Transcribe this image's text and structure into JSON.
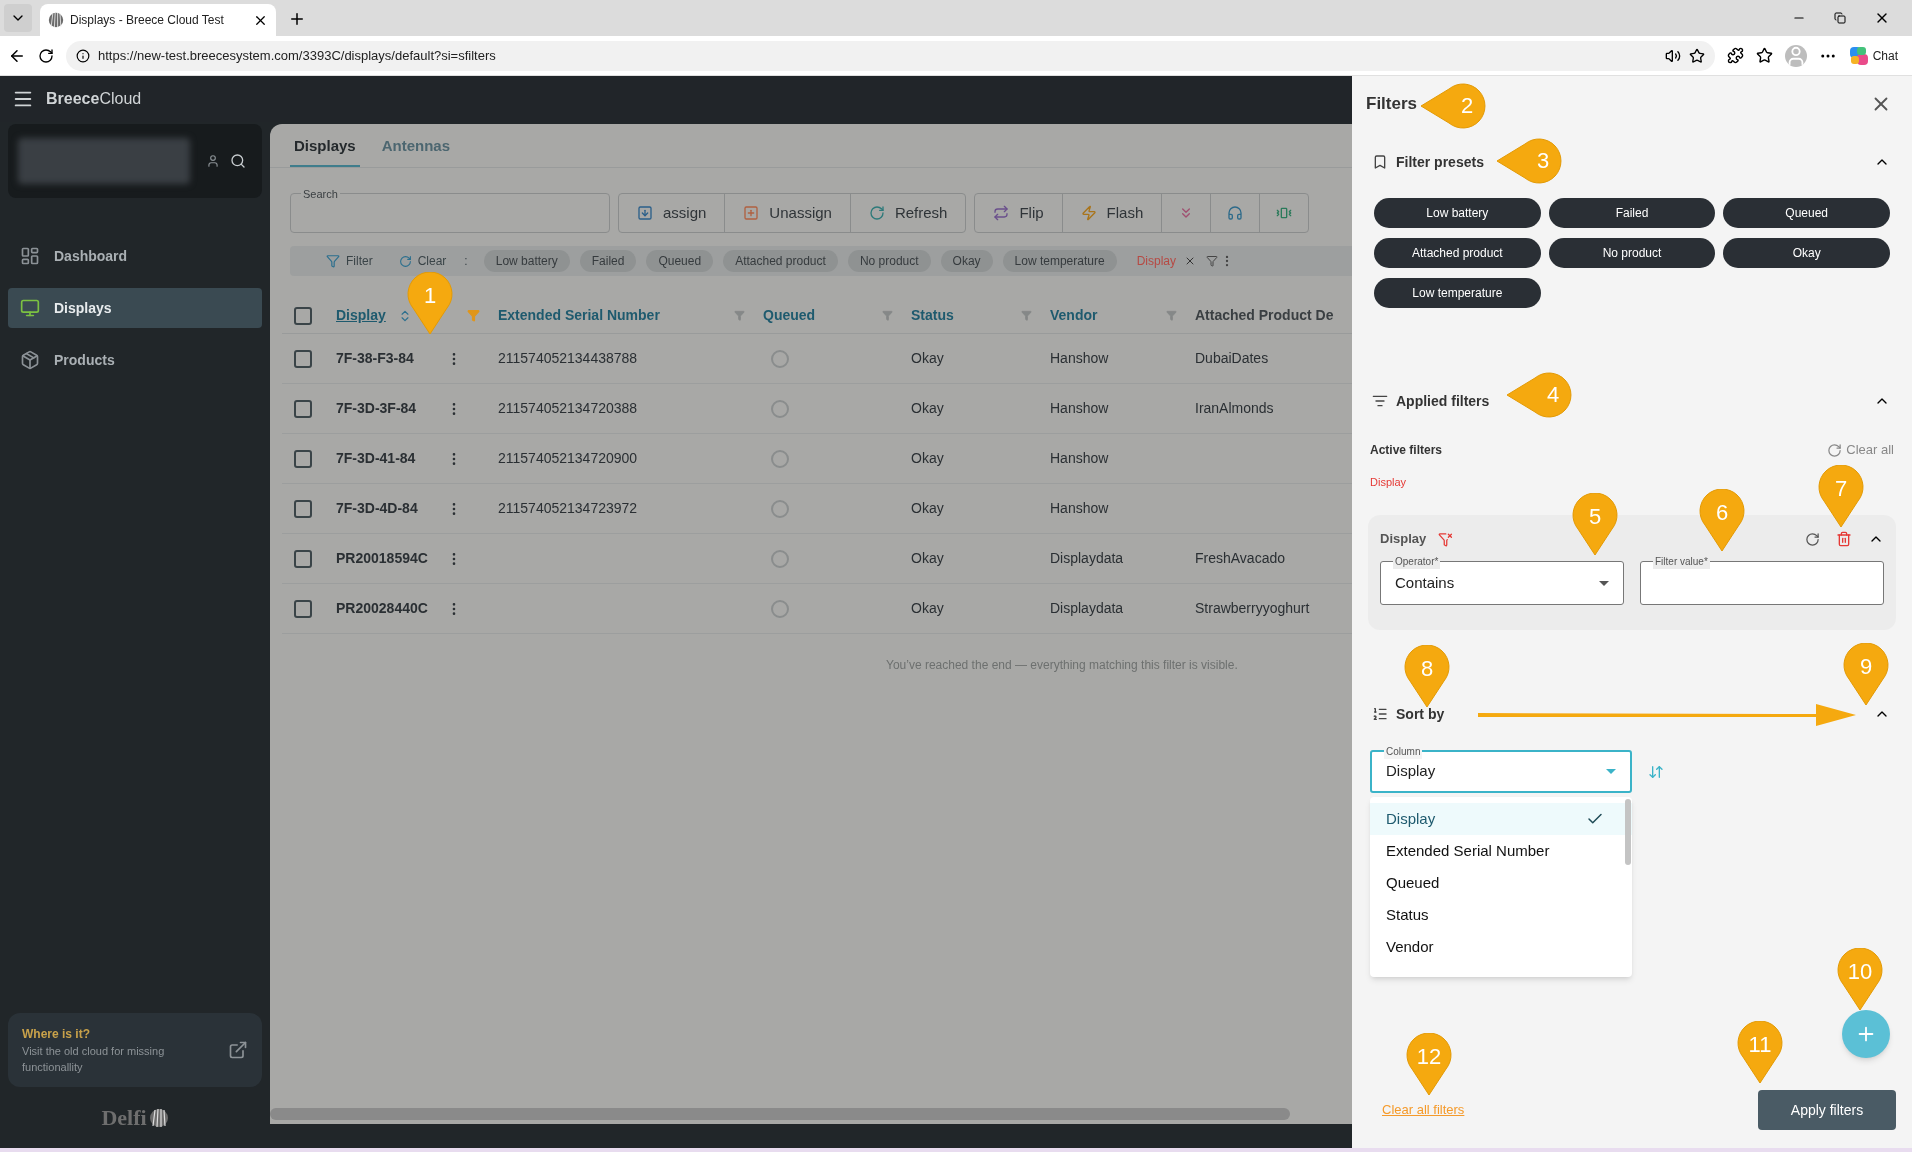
{
  "browser": {
    "tab_title": "Displays - Breece Cloud Test",
    "url": "https://new-test.breecesystem.com/3393C/displays/default?si=sfilters",
    "chat_label": "Chat"
  },
  "app": {
    "brand_bold": "Breece",
    "brand_light": "Cloud"
  },
  "sidebar": {
    "items": [
      {
        "label": "Dashboard",
        "selected": false
      },
      {
        "label": "Displays",
        "selected": true
      },
      {
        "label": "Products",
        "selected": false
      }
    ],
    "promo": {
      "title": "Where is it?",
      "text": "Visit the old cloud for missing functionallity"
    },
    "logo": "Delfi"
  },
  "tabs": [
    {
      "label": "Displays",
      "selected": true
    },
    {
      "label": "Antennas",
      "selected": false
    }
  ],
  "search": {
    "label": "Search"
  },
  "action_groups": [
    {
      "buttons": [
        {
          "kind": "text",
          "label": "assign"
        },
        {
          "kind": "text",
          "label": "Unassign"
        },
        {
          "kind": "text",
          "label": "Refresh"
        }
      ]
    },
    {
      "buttons": [
        {
          "kind": "text",
          "label": "Flip"
        },
        {
          "kind": "text",
          "label": "Flash"
        },
        {
          "kind": "icon"
        },
        {
          "kind": "icon"
        },
        {
          "kind": "icon"
        }
      ]
    }
  ],
  "quick_filters": {
    "filter_label": "Filter",
    "clear_label": "Clear",
    "separator": ":",
    "chips": [
      "Low battery",
      "Failed",
      "Queued",
      "Attached product",
      "No product",
      "Okay",
      "Low temperature"
    ],
    "active": [
      "Display"
    ]
  },
  "table": {
    "columns": [
      {
        "label": "Display",
        "sorted": true,
        "filtered": true
      },
      {
        "label": "Extended Serial Number",
        "sorted": false,
        "filtered": false
      },
      {
        "label": "Queued",
        "sorted": false,
        "filtered": false
      },
      {
        "label": "Status",
        "sorted": false,
        "filtered": false
      },
      {
        "label": "Vendor",
        "sorted": false,
        "filtered": false
      },
      {
        "label": "Attached Product De"
      }
    ],
    "all_checked": false,
    "rows": [
      {
        "display": "7F-38-F3-84",
        "serial": "211574052134438788",
        "queued": false,
        "status": "Okay",
        "vendor": "Hanshow",
        "product": "DubaiDates",
        "checked": false
      },
      {
        "display": "7F-3D-3F-84",
        "serial": "211574052134720388",
        "queued": false,
        "status": "Okay",
        "vendor": "Hanshow",
        "product": "IranAlmonds",
        "checked": false
      },
      {
        "display": "7F-3D-41-84",
        "serial": "211574052134720900",
        "queued": false,
        "status": "Okay",
        "vendor": "Hanshow",
        "product": "",
        "checked": false
      },
      {
        "display": "7F-3D-4D-84",
        "serial": "211574052134723972",
        "queued": false,
        "status": "Okay",
        "vendor": "Hanshow",
        "product": "",
        "checked": false
      },
      {
        "display": "PR20018594C",
        "serial": "",
        "queued": false,
        "status": "Okay",
        "vendor": "Displaydata",
        "product": "FreshAvacado",
        "checked": false
      },
      {
        "display": "PR20028440C",
        "serial": "",
        "queued": false,
        "status": "Okay",
        "vendor": "Displaydata",
        "product": "Strawberryyoghurt",
        "checked": false
      }
    ],
    "end_message": "You’ve reached the end — everything matching this filter is visible."
  },
  "filters_panel": {
    "title": "Filters",
    "presets": {
      "title": "Filter presets",
      "expanded": true,
      "items": [
        "Low battery",
        "Failed",
        "Queued",
        "Attached product",
        "No product",
        "Okay",
        "Low temperature"
      ]
    },
    "applied": {
      "title": "Applied filters",
      "expanded": true,
      "active_label": "Active filters",
      "clear_all": "Clear all",
      "active_items": [
        "Display"
      ],
      "cards": [
        {
          "title": "Display",
          "expanded": true,
          "operator_label": "Operator*",
          "operator": "Contains",
          "value_label": "Filter value*"
        }
      ]
    },
    "sort": {
      "title": "Sort by",
      "expanded": true,
      "column_label": "Column",
      "column": "Display",
      "options": [
        {
          "label": "Display",
          "selected": true
        },
        {
          "label": "Extended Serial Number",
          "selected": false
        },
        {
          "label": "Queued",
          "selected": false
        },
        {
          "label": "Status",
          "selected": false
        },
        {
          "label": "Vendor",
          "selected": false
        }
      ]
    },
    "clear_filters": "Clear all filters",
    "apply": "Apply filters"
  },
  "callouts": [
    {
      "label": "1",
      "kind": "down"
    },
    {
      "label": "2",
      "kind": "left"
    },
    {
      "label": "3",
      "kind": "left"
    },
    {
      "label": "4",
      "kind": "left"
    },
    {
      "label": "5",
      "kind": "down"
    },
    {
      "label": "6",
      "kind": "down"
    },
    {
      "label": "7",
      "kind": "down"
    },
    {
      "label": "8",
      "kind": "down"
    },
    {
      "label": "9",
      "kind": "down"
    },
    {
      "label": "10",
      "kind": "down"
    },
    {
      "label": "11",
      "kind": "down"
    },
    {
      "label": "12",
      "kind": "down"
    }
  ]
}
